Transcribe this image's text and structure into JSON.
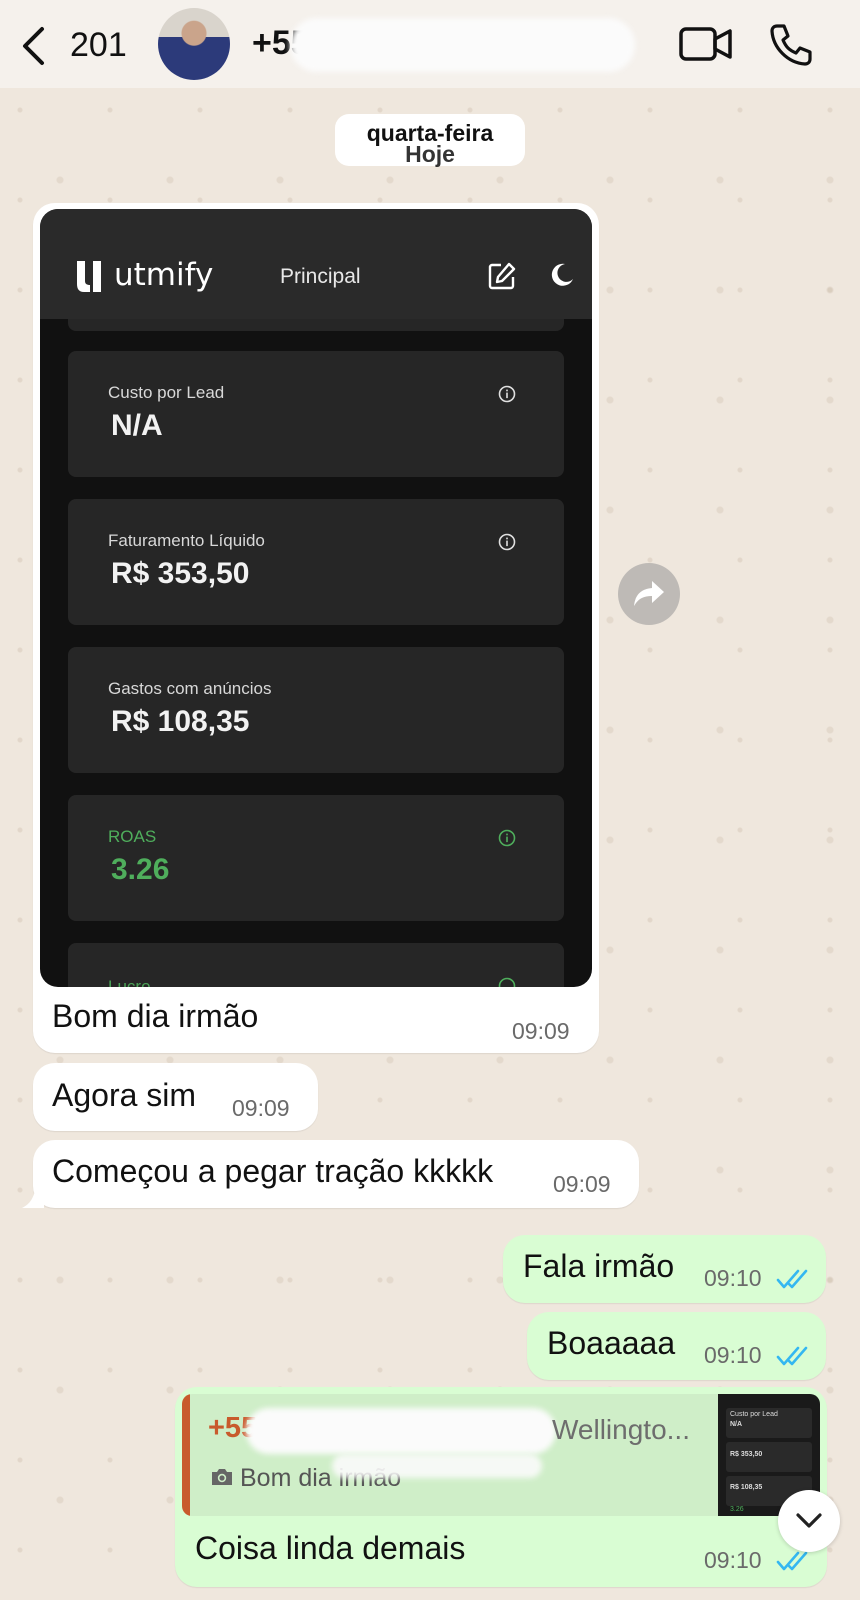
{
  "header": {
    "back_count": "201",
    "contact_visible": "+55",
    "icons": [
      "back-chevron-icon",
      "video-call-icon",
      "phone-call-icon"
    ]
  },
  "date_pill": {
    "top": "quarta-feira",
    "bottom": "Hoje"
  },
  "screenshot": {
    "logo": "utmify",
    "tab": "Principal",
    "cards": [
      {
        "label": "Custo por Lead",
        "value": "N/A"
      },
      {
        "label": "Faturamento Líquido",
        "value": "R$ 353,50"
      },
      {
        "label": "Gastos com anúncios",
        "value": "R$ 108,35"
      },
      {
        "label": "ROAS",
        "value": "3.26"
      },
      {
        "label": "Lucro",
        "value": ""
      }
    ],
    "accent_green": "#4fae5c"
  },
  "messages": [
    {
      "direction": "in",
      "text": "Bom dia irmão",
      "time": "09:09"
    },
    {
      "direction": "in",
      "text": "Agora sim",
      "time": "09:09"
    },
    {
      "direction": "in",
      "text": "Começou a pegar tração kkkkk",
      "time": "09:09"
    },
    {
      "direction": "out",
      "text": "Fala irmão",
      "time": "09:10"
    },
    {
      "direction": "out",
      "text": "Boaaaaa",
      "time": "09:10"
    },
    {
      "direction": "out",
      "text": "Coisa linda demais",
      "time": "09:10"
    }
  ],
  "reply": {
    "sender": "+55",
    "name": "Wellingto...",
    "quoted_text": "Bom dia irmão",
    "thumb": {
      "c1": "Custo por Lead",
      "v1": "N/A",
      "v2": "R$ 353,50",
      "v3": "R$ 108,35",
      "v4": "3.26"
    }
  },
  "colors": {
    "outgoing_bubble": "#d9fdd3",
    "incoming_bubble": "#ffffff",
    "read_ticks": "#34b7f1",
    "reply_accent": "#c85a2c"
  }
}
